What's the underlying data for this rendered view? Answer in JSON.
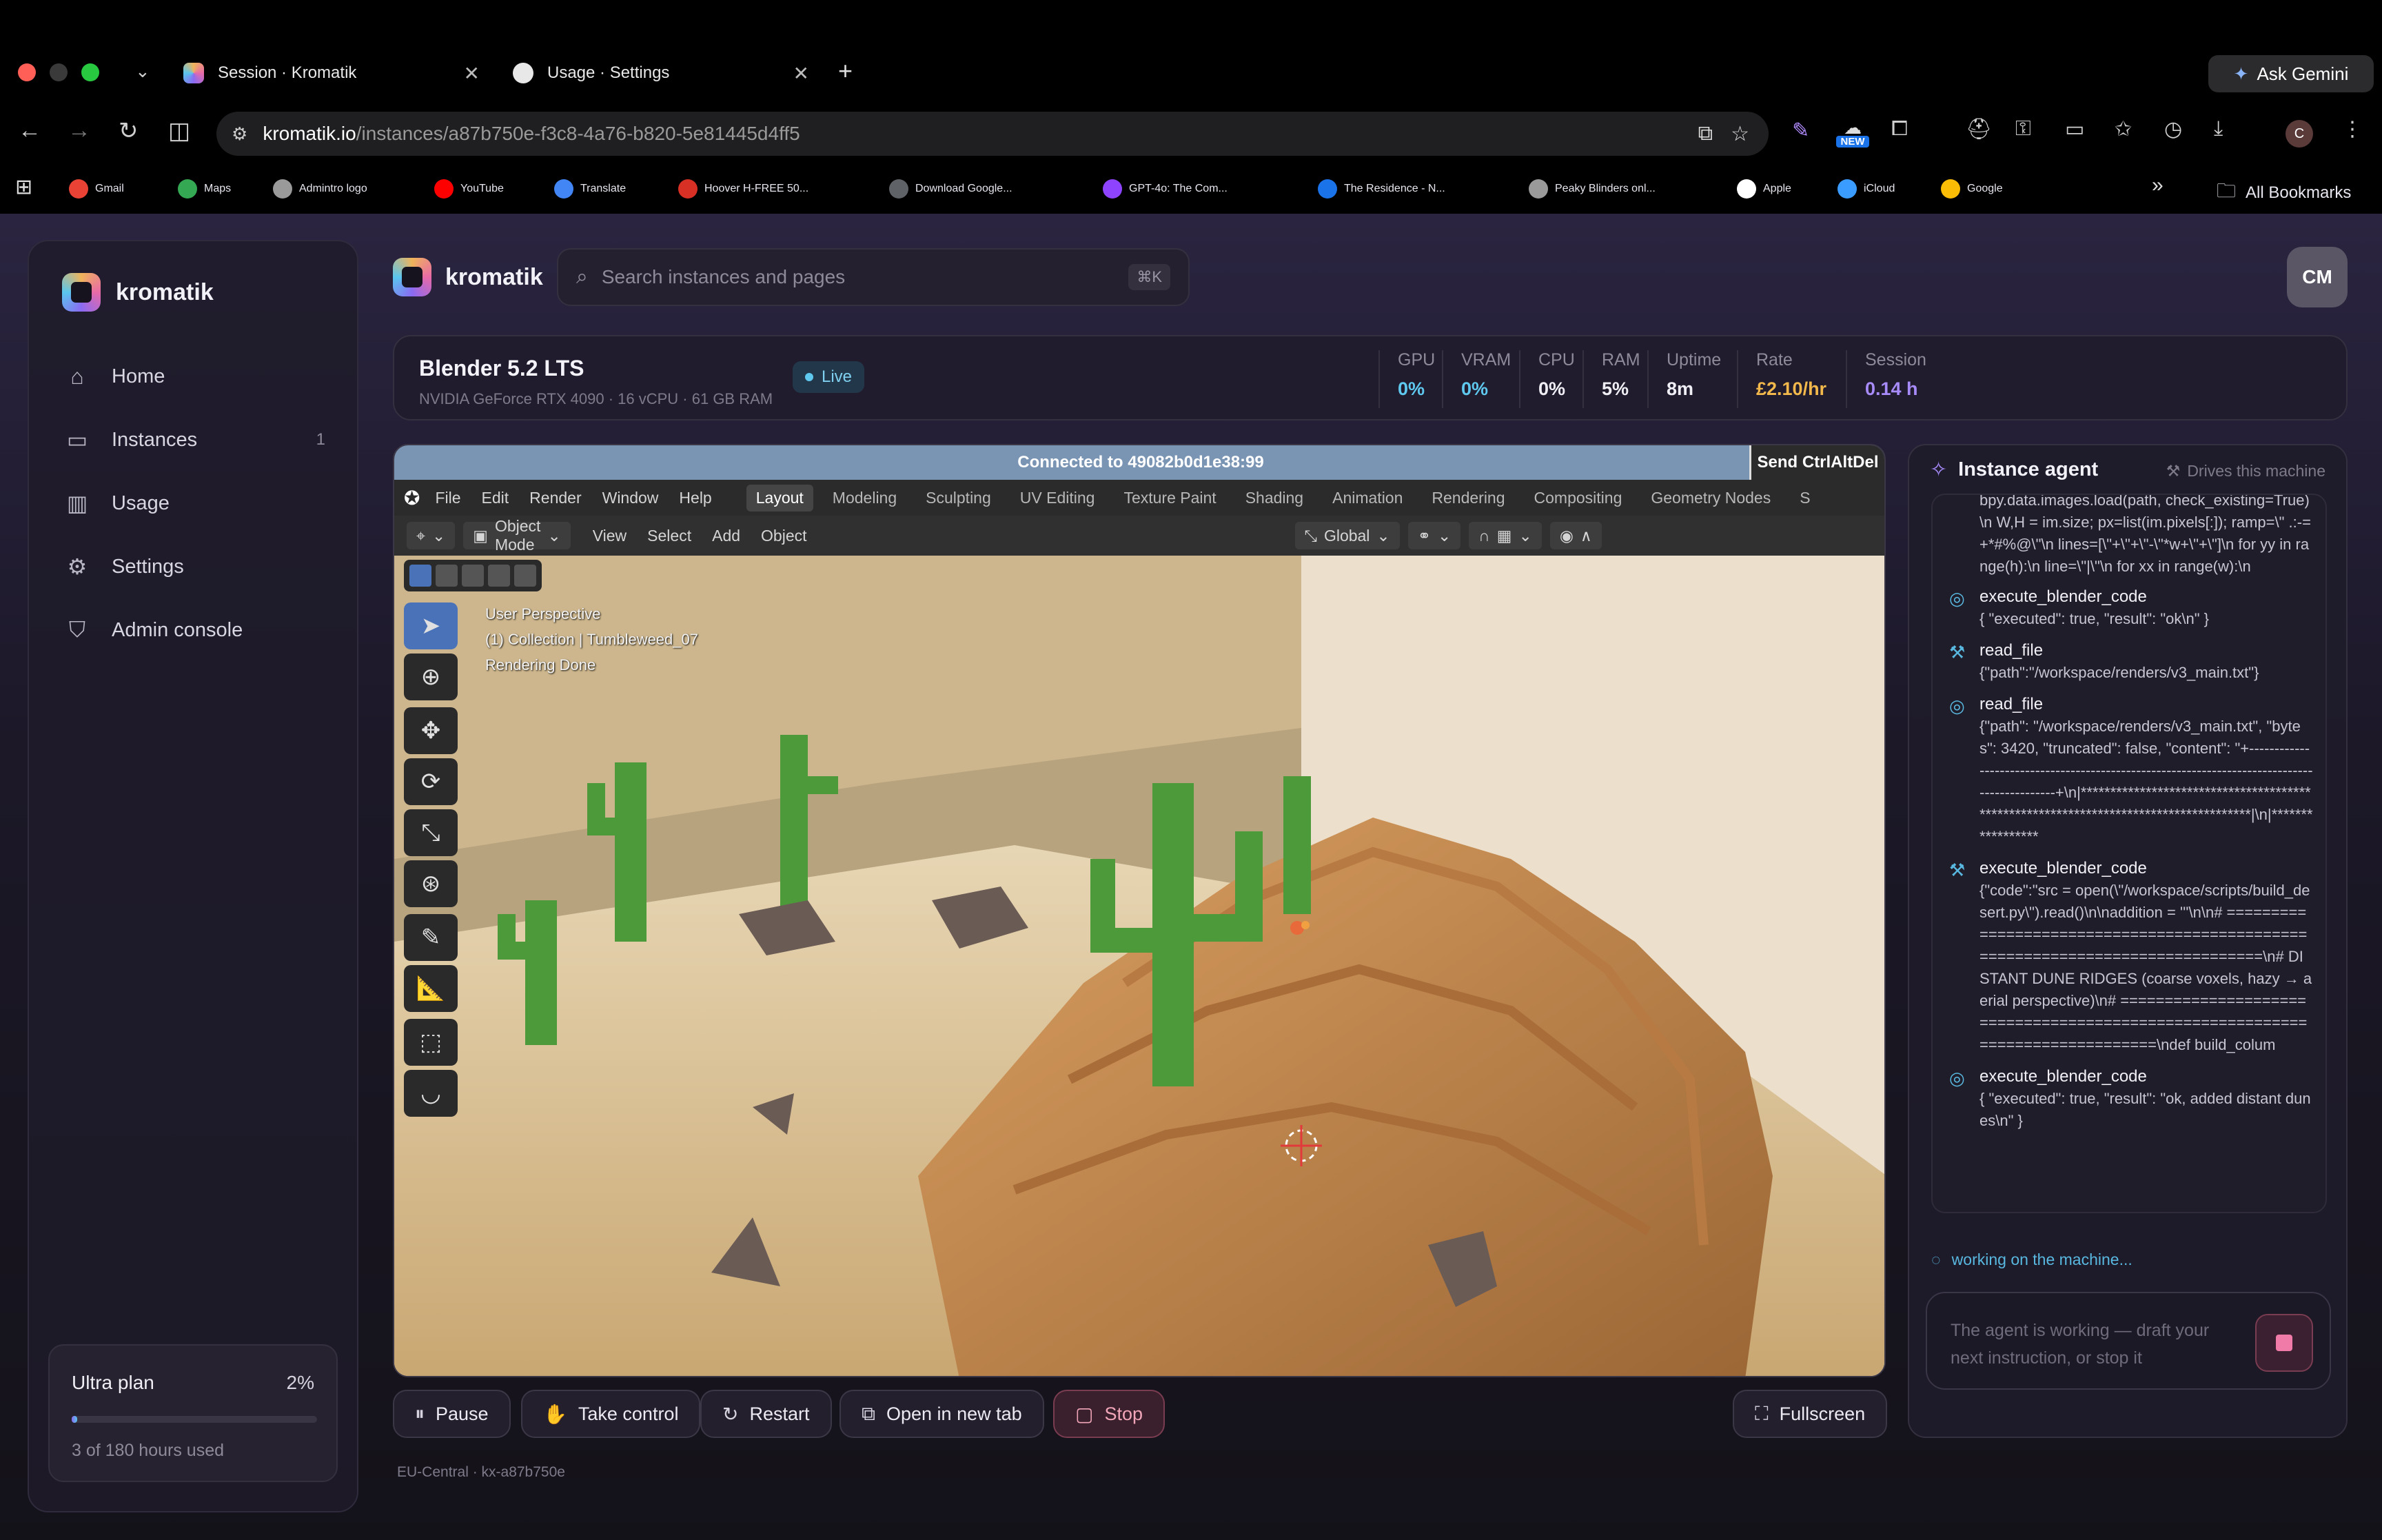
{
  "browser": {
    "tabs": [
      {
        "title": "Session · Kromatik",
        "active": true
      },
      {
        "title": "Usage · Settings",
        "active": false
      }
    ],
    "ask_gemini": "Ask Gemini",
    "url_host": "kromatik.io",
    "url_path": "/instances/a87b750e-f3c8-4a76-b820-5e81445d4ff5",
    "new_badge": "NEW",
    "profile_initial": "C",
    "bookmarks": [
      {
        "label": "Gmail",
        "color": "#ea4335"
      },
      {
        "label": "Maps",
        "color": "#34a853"
      },
      {
        "label": "Admintro logo",
        "color": "#9a9a9a"
      },
      {
        "label": "YouTube",
        "color": "#ff0000"
      },
      {
        "label": "Translate",
        "color": "#4285f4"
      },
      {
        "label": "Hoover H-FREE 50...",
        "color": "#d93025"
      },
      {
        "label": "Download Google...",
        "color": "#5f6368"
      },
      {
        "label": "GPT-4o: The Com...",
        "color": "#8e44ff"
      },
      {
        "label": "The Residence - N...",
        "color": "#1a73e8"
      },
      {
        "label": "Peaky Blinders onl...",
        "color": "#9a9a9a"
      },
      {
        "label": "Apple",
        "color": "#ffffff"
      },
      {
        "label": "iCloud",
        "color": "#3b9cff"
      },
      {
        "label": "Google",
        "color": "#fbbc05"
      }
    ],
    "all_bookmarks": "All Bookmarks"
  },
  "sidebar": {
    "brand": "kromatik",
    "items": [
      {
        "label": "Home",
        "icon": "home-icon",
        "glyph": "⌂",
        "badge": ""
      },
      {
        "label": "Instances",
        "icon": "monitor-icon",
        "glyph": "▭",
        "badge": "1"
      },
      {
        "label": "Usage",
        "icon": "bar-chart-icon",
        "glyph": "▥",
        "badge": ""
      },
      {
        "label": "Settings",
        "icon": "gear-icon",
        "glyph": "⚙",
        "badge": ""
      },
      {
        "label": "Admin console",
        "icon": "shield-icon",
        "glyph": "⛉",
        "badge": ""
      }
    ],
    "plan": {
      "name": "Ultra plan",
      "percent": "2%",
      "fraction": 0.02,
      "usage": "3 of 180 hours used"
    }
  },
  "header": {
    "brand": "kromatik",
    "search_placeholder": "Search instances and pages",
    "search_shortcut": "⌘K",
    "avatar": "CM"
  },
  "instance": {
    "name": "Blender 5.2 LTS",
    "specs": "NVIDIA GeForce RTX 4090 · 16 vCPU · 61 GB RAM",
    "status": "Live",
    "metrics": [
      {
        "label": "GPU",
        "value": "0%",
        "color": "#5fc8ee"
      },
      {
        "label": "VRAM",
        "value": "0%",
        "color": "#5fc8ee"
      },
      {
        "label": "CPU",
        "value": "0%",
        "color": "#f0eef5"
      },
      {
        "label": "RAM",
        "value": "5%",
        "color": "#f0eef5"
      },
      {
        "label": "Uptime",
        "value": "8m",
        "color": "#f0eef5"
      },
      {
        "label": "Rate",
        "value": "£2.10/hr",
        "color": "#f2b84b"
      },
      {
        "label": "Session",
        "value": "0.14 h",
        "color": "#a78bfa"
      }
    ]
  },
  "remote": {
    "connected": "Connected to 49082b0d1e38:99",
    "send_cad": "Send CtrlAltDel",
    "menu": [
      "File",
      "Edit",
      "Render",
      "Window",
      "Help"
    ],
    "workspaces": [
      "Layout",
      "Modeling",
      "Sculpting",
      "UV Editing",
      "Texture Paint",
      "Shading",
      "Animation",
      "Rendering",
      "Compositing",
      "Geometry Nodes",
      "S"
    ],
    "mode": "Object Mode",
    "view_menu": [
      "View",
      "Select",
      "Add",
      "Object"
    ],
    "orientation": "Global",
    "overlay_lines": [
      "User Perspective",
      "(1) Collection | Tumbleweed_07",
      "Rendering Done"
    ]
  },
  "controls": {
    "pause": "Pause",
    "take_control": "Take control",
    "restart": "Restart",
    "open_tab": "Open in new tab",
    "stop": "Stop",
    "fullscreen": "Fullscreen",
    "region": "EU-Central · kx-a87b750e"
  },
  "agent": {
    "title": "Instance agent",
    "drives": "Drives this machine",
    "log_head": "bpy.data.images.load(path, check_existing=True)\\n W,H = im.size; px=list(im.pixels[:]); ramp=\\\" .:-=+*#%@\\\"\\n lines=[\\\"+\\\"+\\\"-\\\"*w+\\\"+\\\"]\\n for yy in range(h):\\n line=\\\"|\\\"\\n for xx in range(w):\\n",
    "entries": [
      {
        "kind": "done",
        "tool": "execute_blender_code",
        "body": "{ \"executed\": true, \"result\": \"ok\\n\" }"
      },
      {
        "kind": "call",
        "tool": "read_file",
        "body": "{\"path\":\"/workspace/renders/v3_main.txt\"}"
      },
      {
        "kind": "done",
        "tool": "read_file",
        "body": "{\"path\": \"/workspace/renders/v3_main.txt\", \"bytes\": 3420, \"truncated\": false, \"content\": \"+---------------------------------------------------------------------------------------------+\\n|*************************************************************************************|\\n|*****************"
      },
      {
        "kind": "call",
        "tool": "execute_blender_code",
        "body": "{\"code\":\"src = open(\\\"/workspace/scripts/build_desert.py\\\").read()\\n\\naddition = '''\\n\\n# ==============================================================================\\n# DISTANT DUNE RIDGES (coarse voxels, hazy → aerial perspective)\\n# ==============================================================================\\ndef build_colum"
      },
      {
        "kind": "done",
        "tool": "execute_blender_code",
        "body": "{ \"executed\": true, \"result\": \"ok, added distant dunes\\n\" }"
      }
    ],
    "working": "working on the machine...",
    "composer_placeholder": "The agent is working — draft your next instruction, or stop it"
  }
}
